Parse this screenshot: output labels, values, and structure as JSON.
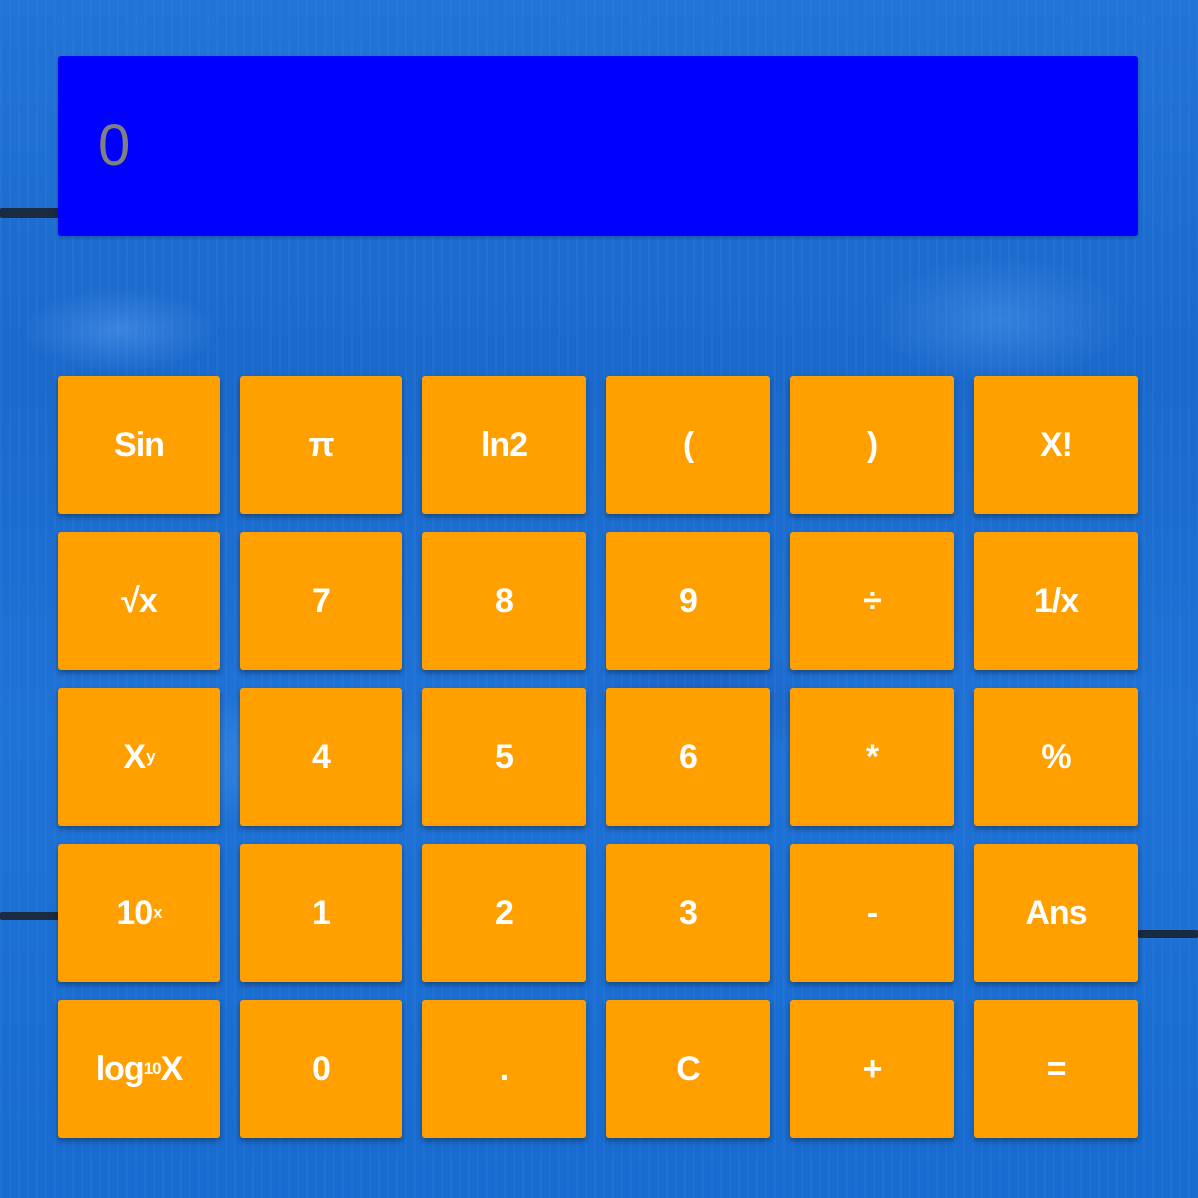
{
  "display": {
    "value": "0"
  },
  "colors": {
    "display_background": "#0000ff",
    "display_text": "#808080",
    "key_background": "#ff9f00",
    "key_text": "#ffffff",
    "page_background": "#1c6fd2"
  },
  "keys": [
    {
      "label": "Sin",
      "name": "sin-button"
    },
    {
      "label": "π",
      "name": "pi-button"
    },
    {
      "label": "ln2",
      "name": "ln2-button"
    },
    {
      "label": "(",
      "name": "open-paren-button"
    },
    {
      "label": ")",
      "name": "close-paren-button"
    },
    {
      "label": "X!",
      "name": "factorial-button"
    },
    {
      "label": "√x",
      "name": "sqrt-button"
    },
    {
      "label": "7",
      "name": "digit-7-button"
    },
    {
      "label": "8",
      "name": "digit-8-button"
    },
    {
      "label": "9",
      "name": "digit-9-button"
    },
    {
      "label": "÷",
      "name": "divide-button"
    },
    {
      "label": "1/x",
      "name": "reciprocal-button"
    },
    {
      "label": "X",
      "sup": "y",
      "name": "power-button"
    },
    {
      "label": "4",
      "name": "digit-4-button"
    },
    {
      "label": "5",
      "name": "digit-5-button"
    },
    {
      "label": "6",
      "name": "digit-6-button"
    },
    {
      "label": "*",
      "name": "multiply-button"
    },
    {
      "label": "%",
      "name": "percent-button"
    },
    {
      "label": "10",
      "sup": "x",
      "name": "ten-power-button"
    },
    {
      "label": "1",
      "name": "digit-1-button"
    },
    {
      "label": "2",
      "name": "digit-2-button"
    },
    {
      "label": "3",
      "name": "digit-3-button"
    },
    {
      "label": "-",
      "name": "subtract-button"
    },
    {
      "label": "Ans",
      "name": "ans-button"
    },
    {
      "label": "log",
      "sub": "10",
      "after": "X",
      "name": "log10-button"
    },
    {
      "label": "0",
      "name": "digit-0-button"
    },
    {
      "label": ".",
      "name": "decimal-button"
    },
    {
      "label": "C",
      "name": "clear-button"
    },
    {
      "label": "+",
      "name": "add-button"
    },
    {
      "label": "=",
      "name": "equals-button"
    }
  ]
}
